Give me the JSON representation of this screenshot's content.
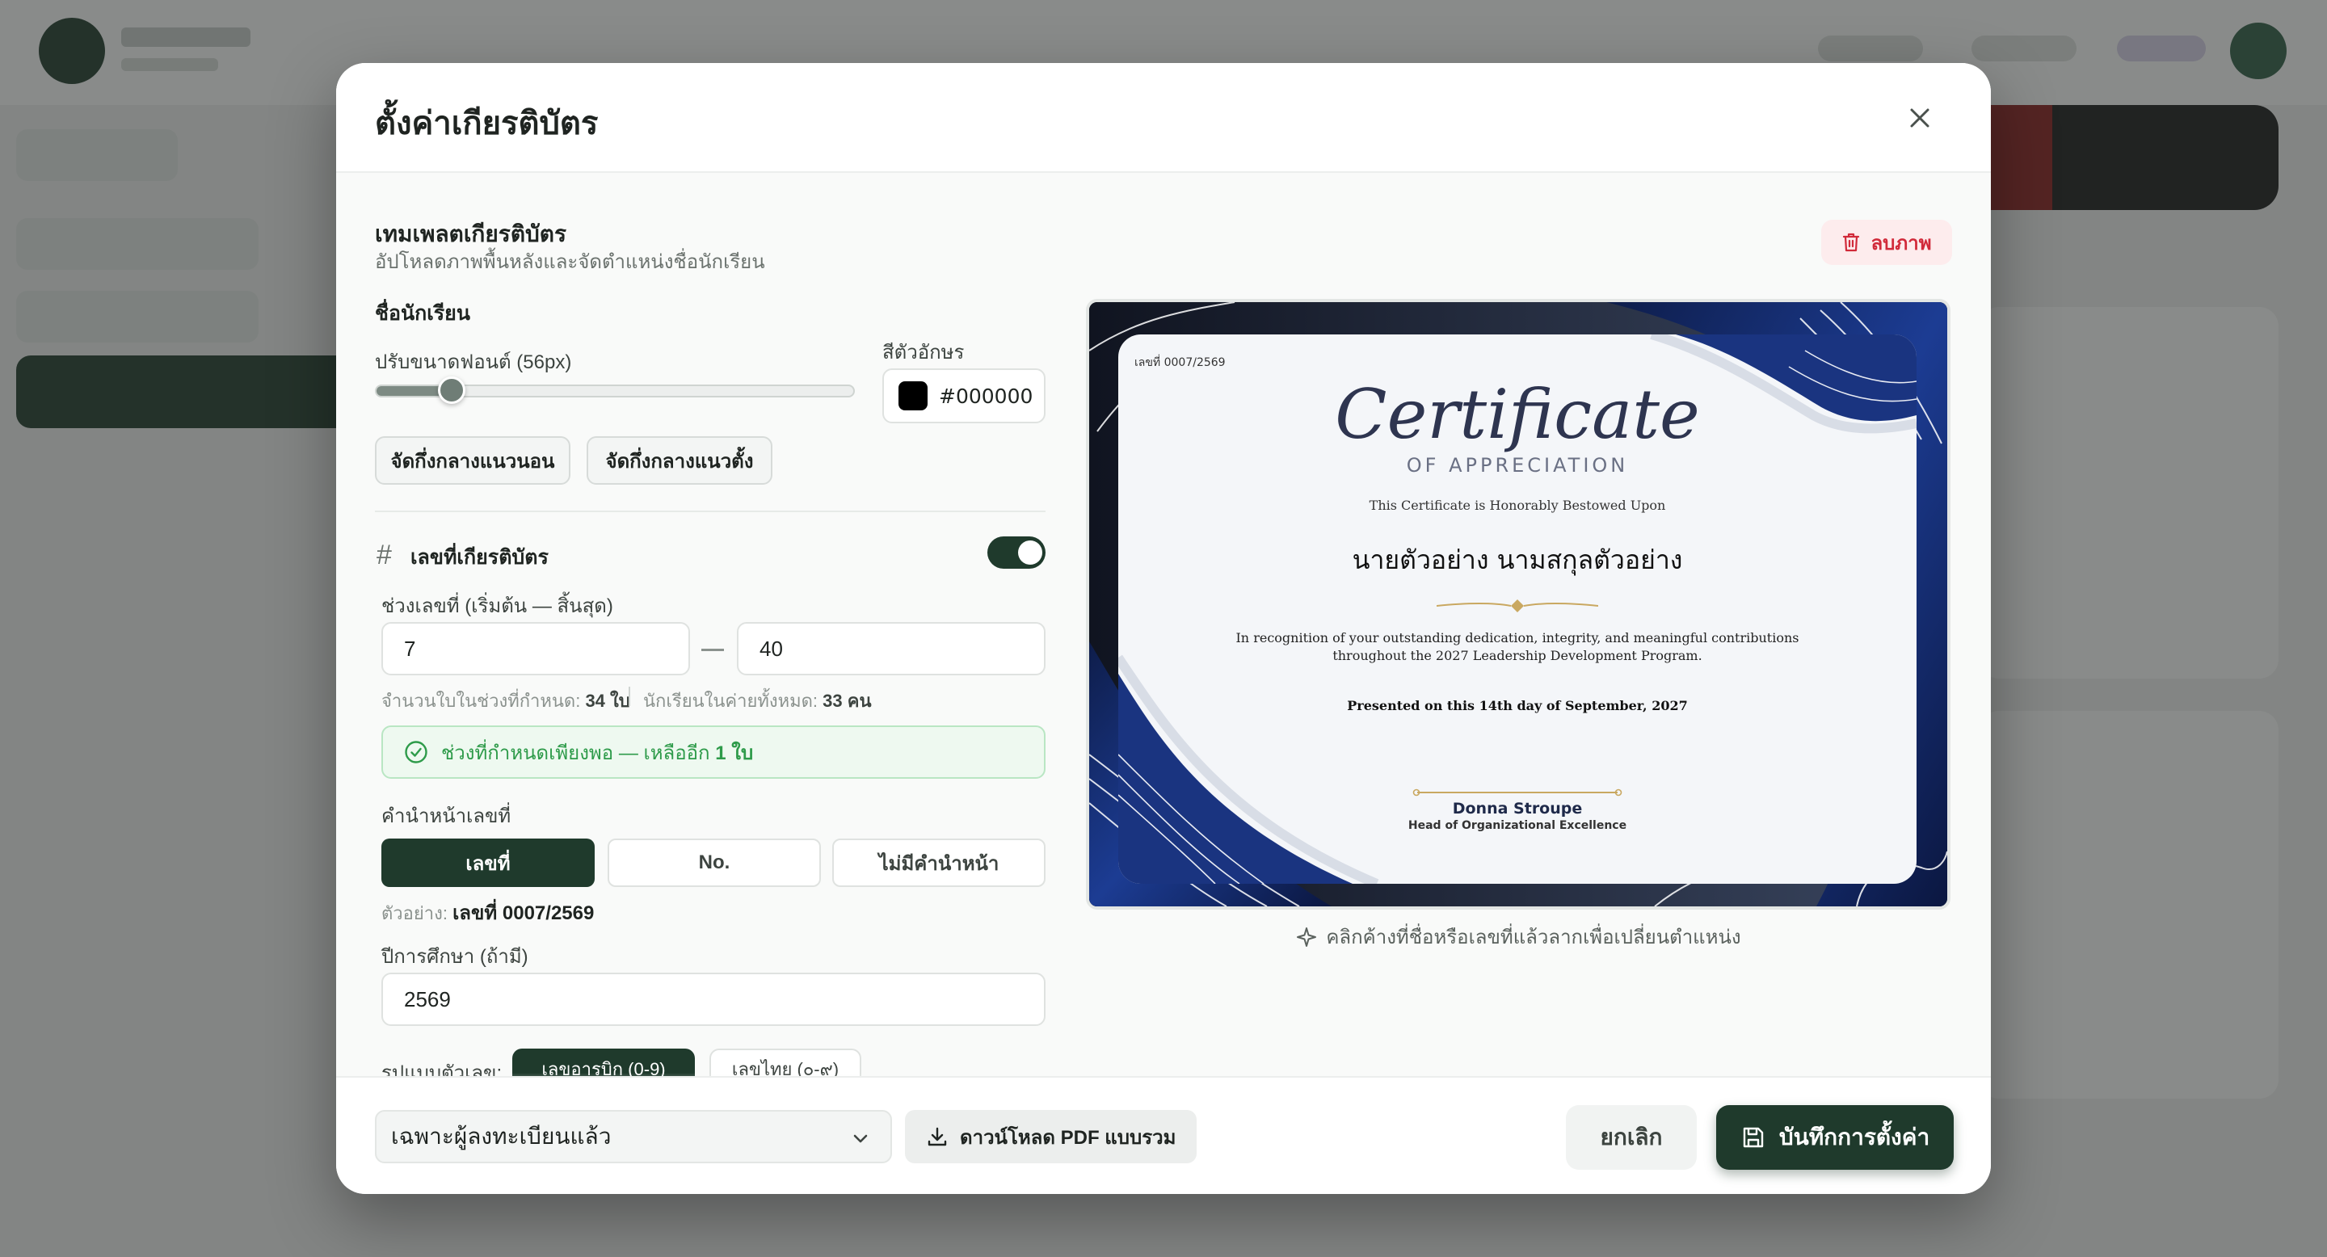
{
  "modal": {
    "title": "ตั้งค่าเกียรติบัตร"
  },
  "template": {
    "title": "เทมเพลตเกียรติบัตร",
    "subtitle": "อัปโหลดภาพพื้นหลังและจัดตำแหน่งชื่อนักเรียน",
    "delete_label": "ลบภาพ"
  },
  "student_name": {
    "heading": "ชื่อนักเรียน",
    "font_size_label": "ปรับขนาดฟอนต์ (56px)",
    "font_size_fraction": 0.16,
    "color_label": "สีตัวอักษร",
    "color_value": "#000000",
    "center_horizontal_label": "จัดกึ่งกลางแนวนอน",
    "center_vertical_label": "จัดกึ่งกลางแนวตั้ง"
  },
  "cert_number": {
    "heading": "เลขที่เกียรติบัตร",
    "enabled": true,
    "range_label": "ช่วงเลขที่ (เริ่มต้น — สิ้นสุด)",
    "range_start": "7",
    "range_end": "40",
    "count_label": "จำนวนใบในช่วงที่กำหนด:",
    "count_value": "34 ใบ",
    "students_label": "นักเรียนในค่ายทั้งหมด:",
    "students_value": "33 คน",
    "success_text": "ช่วงที่กำหนดเพียงพอ — เหลืออีก",
    "success_value": "1 ใบ",
    "prefix_label": "คำนำหน้าเลขที่",
    "prefix_options": [
      "เลขที่",
      "No.",
      "ไม่มีคำนำหน้า"
    ],
    "example_label": "ตัวอย่าง:",
    "example_value": "เลขที่ 0007/2569",
    "year_label": "ปีการศึกษา (ถ้ามี)",
    "year_value": "2569",
    "digit_format_label": "รูปแบบตัวเลข:",
    "digit_format_options": [
      "เลขอารบิก (0-9)",
      "เลขไทย (๐-๙)"
    ]
  },
  "preview": {
    "cert_number": "เลขที่ 0007/2569",
    "title_script": "Certificate",
    "title_sub": "OF APPRECIATION",
    "bestowed": "This Certificate is Honorably Bestowed Upon",
    "recipient": "นายตัวอย่าง นามสกุลตัวอย่าง",
    "body_line1": "In recognition of your outstanding dedication, integrity, and meaningful contributions",
    "body_line2": "throughout the 2027 Leadership Development Program.",
    "presented": "Presented on this 14th day of September, 2027",
    "signer_name": "Donna Stroupe",
    "signer_title": "Head of Organizational Excellence",
    "hint": "คลิกค้างที่ชื่อหรือเลขที่แล้วลากเพื่อเปลี่ยนตำแหน่ง"
  },
  "footer": {
    "filter_value": "เฉพาะผู้ลงทะเบียนแล้ว",
    "download_label": "ดาวน์โหลด PDF แบบรวม",
    "cancel_label": "ยกเลิก",
    "save_label": "บันทึกการตั้งค่า"
  },
  "colors": {
    "primary": "#1f3a2c",
    "danger": "#d12a3a",
    "success": "#2e9b4a",
    "cert_navy": "#16306e"
  }
}
